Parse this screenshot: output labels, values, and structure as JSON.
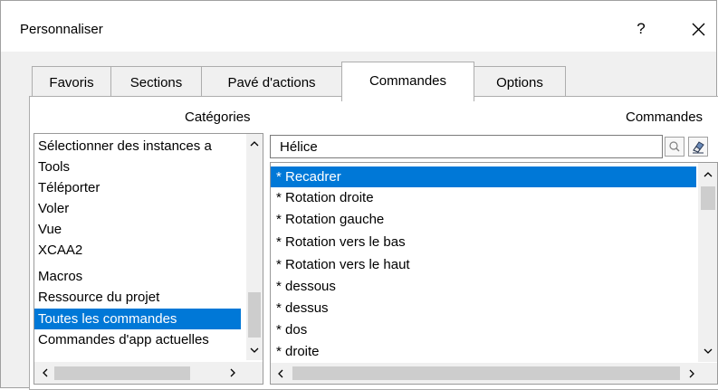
{
  "window": {
    "title": "Personnaliser",
    "help_label": "?"
  },
  "tabs": [
    {
      "label": "Favoris",
      "active": false
    },
    {
      "label": "Sections",
      "active": false
    },
    {
      "label": "Pavé d'actions",
      "active": false
    },
    {
      "label": "Commandes",
      "active": true
    },
    {
      "label": "Options",
      "active": false
    }
  ],
  "categories": {
    "label": "Catégories",
    "selected_index": 7,
    "items": [
      "Sélectionner des instances a",
      "Tools",
      "Téléporter",
      "Voler",
      "Vue",
      "XCAA2",
      "Macros",
      "Ressource du projet",
      "Toutes les commandes",
      "Commandes d'app actuelles"
    ]
  },
  "commands": {
    "label": "Commandes",
    "search_value": "Hélice",
    "selected_index": 0,
    "items": [
      "* Recadrer",
      "* Rotation droite",
      "* Rotation gauche",
      "* Rotation vers le bas",
      "* Rotation vers le haut",
      "* dessous",
      "* dessus",
      "* dos",
      "* droite"
    ]
  },
  "colors": {
    "selection": "#0078d7",
    "dialog_background": "#f0f0f0"
  },
  "icons": {
    "search": "magnifier-icon",
    "clear": "eraser-icon",
    "close": "close-icon"
  }
}
